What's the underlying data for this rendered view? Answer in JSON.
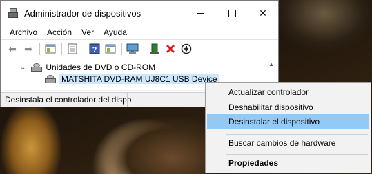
{
  "window": {
    "title": "Administrador de dispositivos",
    "controls": {
      "minimize": "minimize-icon",
      "maximize": "maximize-icon",
      "close": "✕"
    }
  },
  "menubar": [
    "Archivo",
    "Acción",
    "Ver",
    "Ayuda"
  ],
  "toolbar": {
    "icons": [
      "back-arrow-icon",
      "forward-arrow-icon",
      "properties-icon",
      "update-driver-icon",
      "help-icon",
      "view-icon",
      "monitor-icon",
      "add-driver-icon",
      "uninstall-icon",
      "disable-device-icon"
    ],
    "uninstall_color": "#d42020"
  },
  "tree": {
    "category": "Unidades de DVD o CD-ROM",
    "expand_glyph": "⌄",
    "device": "MATSHITA DVD-RAM UJ8C1 USB Device",
    "selected_bg": "#cce8ff"
  },
  "status_text": "Desinstala el controlador del dispo",
  "context_menu": {
    "items": [
      "Actualizar controlador",
      "Deshabilitar dispositivo",
      "Desinstalar el dispositivo",
      "Buscar cambios de hardware",
      "Propiedades"
    ],
    "highlighted": "Desinstalar el dispositivo",
    "highlight_color": "#91c9f7"
  }
}
